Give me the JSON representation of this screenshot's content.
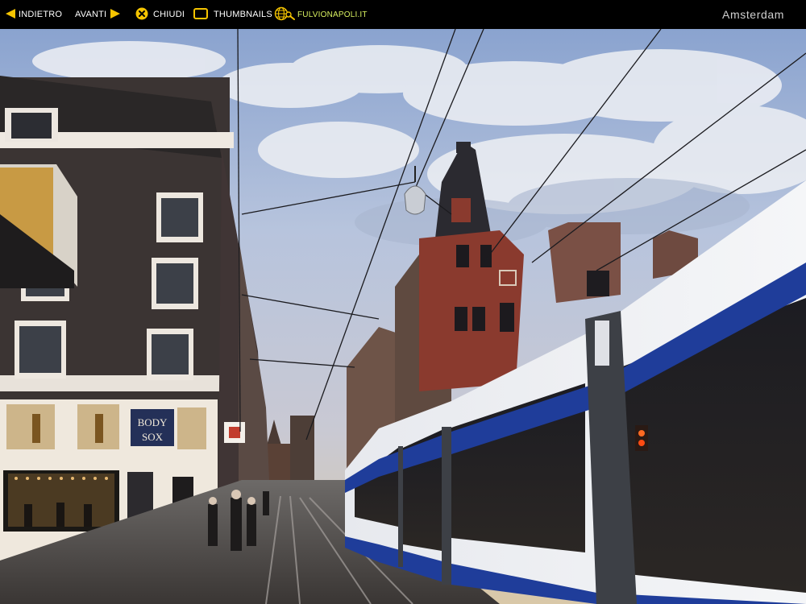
{
  "toolbar": {
    "back_label": "INDIETRO",
    "forward_label": "AVANTI",
    "close_label": "CHIUDI",
    "thumbnails_label": "THUMBNAILS",
    "site_label": "FULVIONAPOLI.IT",
    "icons": {
      "back": "arrow-left-icon",
      "forward": "arrow-right-icon",
      "close": "close-icon",
      "thumbnails": "thumbnails-icon",
      "site": "globe-magnifier-icon"
    },
    "accent_color": "#f5c400",
    "site_color": "#d8f060"
  },
  "gallery": {
    "title": "Amsterdam"
  },
  "photo": {
    "shop_sign_line1": "BODY",
    "shop_sign_line2": "SOX"
  }
}
